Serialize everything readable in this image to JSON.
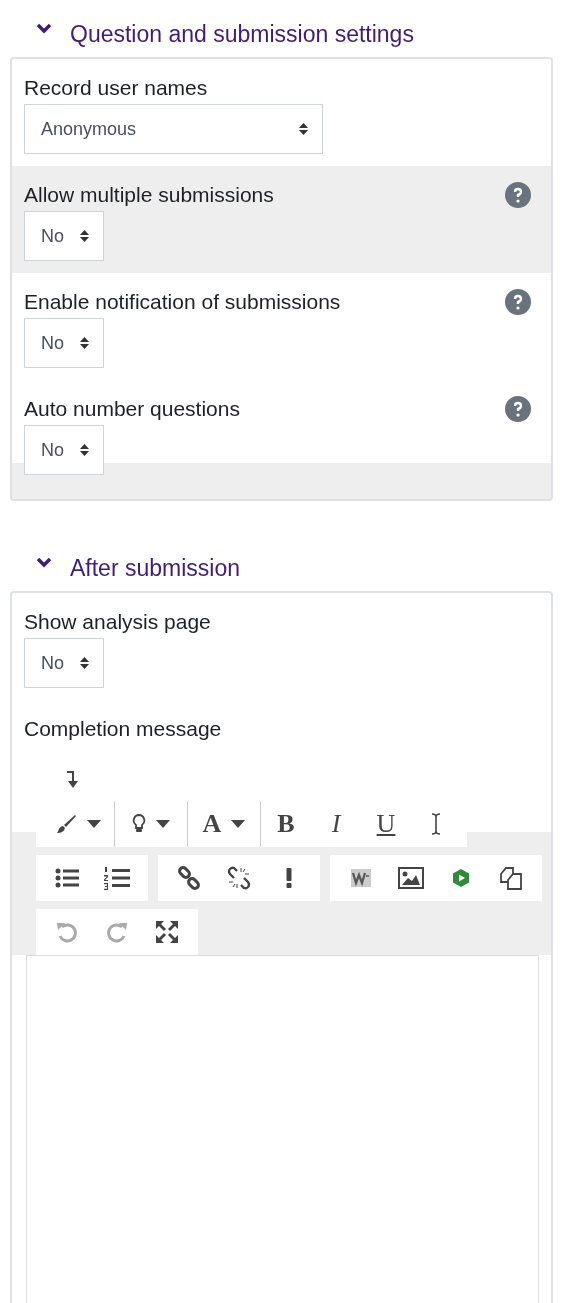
{
  "sections": [
    {
      "title": "Question and submission settings",
      "expanded": true,
      "fields": [
        {
          "kind": "select",
          "label": "Record user names",
          "value": "Anonymous",
          "highlighted": false,
          "help": false,
          "wide": true
        },
        {
          "kind": "select",
          "label": "Allow multiple submissions",
          "value": "No",
          "highlighted": true,
          "help": true,
          "wide": false
        },
        {
          "kind": "select",
          "label": "Enable notification of submissions",
          "value": "No",
          "highlighted": false,
          "help": true,
          "wide": false
        },
        {
          "kind": "select",
          "label": "Auto number questions",
          "value": "No",
          "highlighted": false,
          "help": true,
          "wide": false
        }
      ]
    },
    {
      "title": "After submission",
      "expanded": true,
      "fields": [
        {
          "kind": "select",
          "label": "Show analysis page",
          "value": "No",
          "highlighted": false,
          "help": false,
          "wide": false
        },
        {
          "kind": "editor",
          "label": "Completion message",
          "toolbar_rows": [
            [
              [
                {
                  "kind": "brush",
                  "disabled": false
                },
                {
                  "kind": "bulb",
                  "disabled": false
                },
                {
                  "kind": "fontcolor",
                  "label": "A",
                  "disabled": false
                },
                {
                  "kind": "bold",
                  "label": "B",
                  "disabled": false
                },
                {
                  "kind": "italic",
                  "label": "I",
                  "disabled": false
                },
                {
                  "kind": "underline",
                  "label": "U",
                  "disabled": false
                },
                {
                  "kind": "cursor",
                  "disabled": false
                }
              ]
            ],
            [
              [
                {
                  "kind": "bullets",
                  "disabled": false
                },
                {
                  "kind": "numbers",
                  "disabled": false
                }
              ],
              [
                {
                  "kind": "link",
                  "disabled": false
                },
                {
                  "kind": "unlink",
                  "disabled": false
                },
                {
                  "kind": "exclaim",
                  "disabled": false
                }
              ],
              [
                {
                  "kind": "word",
                  "disabled": false
                },
                {
                  "kind": "image",
                  "disabled": false
                },
                {
                  "kind": "media",
                  "disabled": false
                },
                {
                  "kind": "paste",
                  "disabled": false
                }
              ]
            ],
            [
              [
                {
                  "kind": "undo",
                  "disabled": true
                },
                {
                  "kind": "redo",
                  "disabled": true
                },
                {
                  "kind": "fullscreen",
                  "disabled": false
                }
              ]
            ]
          ]
        }
      ]
    }
  ]
}
